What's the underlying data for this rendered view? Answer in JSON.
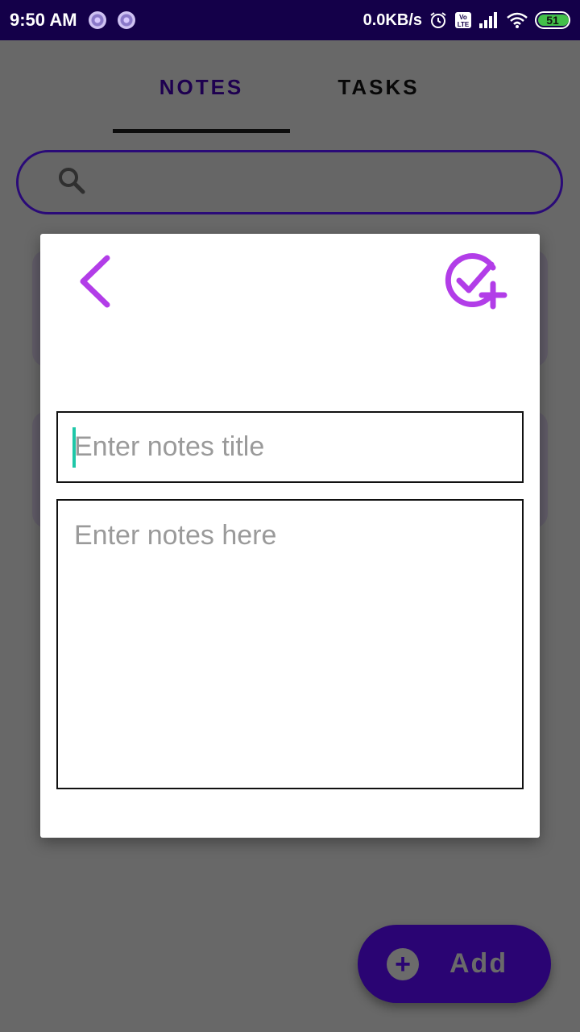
{
  "status_bar": {
    "time": "9:50 AM",
    "network_speed": "0.0KB/s",
    "battery_level": "51",
    "icons": [
      "notification-dot-icon",
      "notification-dot-icon",
      "alarm-icon",
      "volte-icon",
      "signal-icon",
      "wifi-icon",
      "battery-icon"
    ]
  },
  "tabs": [
    {
      "label": "NOTES",
      "selected": true
    },
    {
      "label": "TASKS",
      "selected": false
    }
  ],
  "search": {
    "icon": "search-icon",
    "placeholder": ""
  },
  "modal": {
    "back_icon": "chevron-left-icon",
    "save_icon": "check-circle-plus-icon",
    "title_placeholder": "Enter notes title",
    "body_placeholder": "Enter notes here"
  },
  "fab": {
    "icon": "add-circle-icon",
    "label": "Add"
  },
  "colors": {
    "status_bar": "#140049",
    "accent": "#b23de8",
    "primary_dark": "#2a0473",
    "scrim": "#686868",
    "caret": "#1fc7a8"
  }
}
